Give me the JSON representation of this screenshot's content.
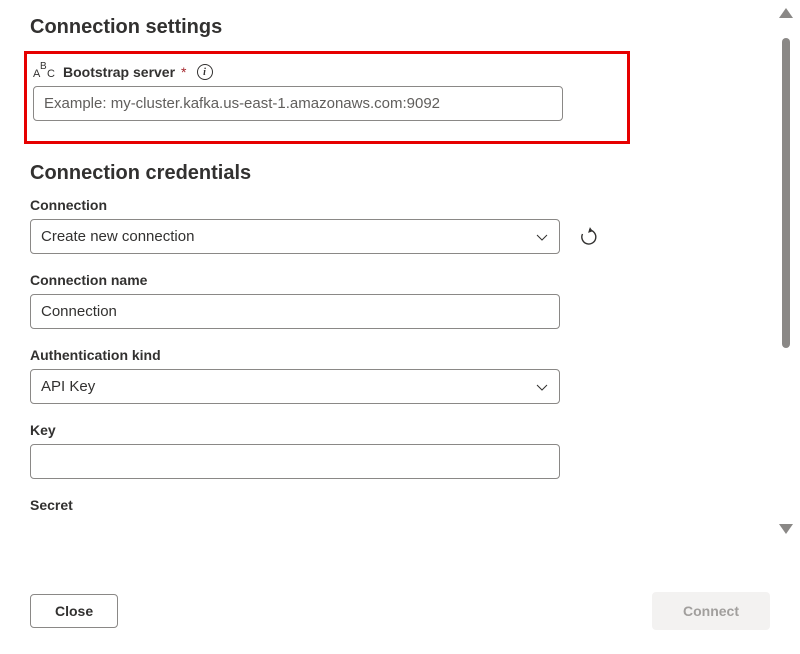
{
  "sections": {
    "settings_heading": "Connection settings",
    "credentials_heading": "Connection credentials"
  },
  "bootstrap": {
    "label": "Bootstrap server",
    "required_marker": "*",
    "placeholder": "Example: my-cluster.kafka.us-east-1.amazonaws.com:9092",
    "value": ""
  },
  "connection": {
    "label": "Connection",
    "selected": "Create new connection"
  },
  "connection_name": {
    "label": "Connection name",
    "value": "Connection"
  },
  "auth_kind": {
    "label": "Authentication kind",
    "selected": "API Key"
  },
  "key": {
    "label": "Key",
    "value": ""
  },
  "secret": {
    "label": "Secret"
  },
  "footer": {
    "close_label": "Close",
    "connect_label": "Connect"
  }
}
